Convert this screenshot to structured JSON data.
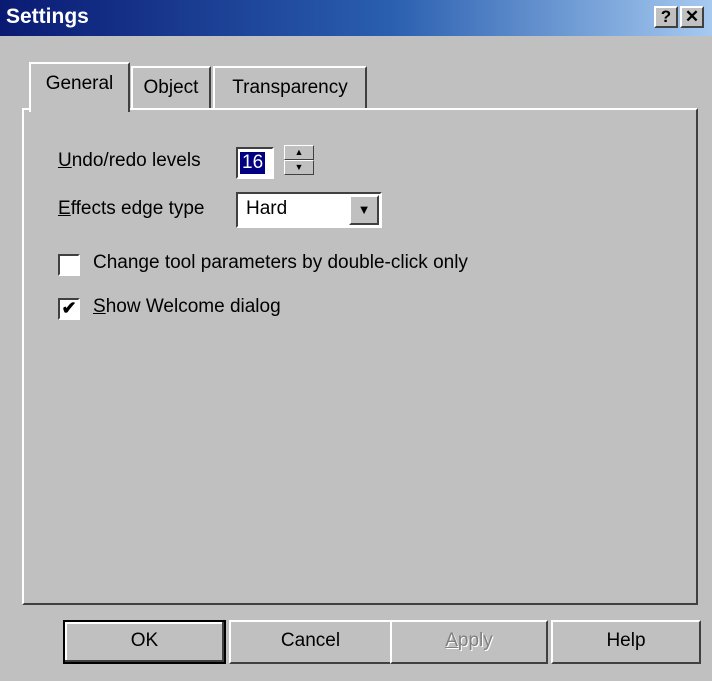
{
  "window": {
    "title": "Settings",
    "help_glyph": "?",
    "close_glyph": "✕"
  },
  "tabs": [
    {
      "label": "General",
      "active": true
    },
    {
      "label": "Object",
      "active": false
    },
    {
      "label": "Transparency",
      "active": false
    }
  ],
  "general": {
    "undo_label_mnemonic": "U",
    "undo_label_rest": "ndo/redo levels",
    "undo_value": "16",
    "edge_label_mnemonic": "E",
    "edge_label_rest": "ffects edge type",
    "edge_value": "Hard",
    "change_tool_label": "Change tool parameters by double-click only",
    "change_tool_checked": false,
    "welcome_label_mnemonic": "S",
    "welcome_label_rest": "how Welcome dialog",
    "welcome_checked": true
  },
  "buttons": {
    "ok": "OK",
    "cancel": "Cancel",
    "apply_mnemonic": "A",
    "apply_rest": "pply",
    "help": "Help"
  },
  "icons": {
    "spin_up": "▲",
    "spin_down": "▼",
    "combo_arrow": "▼",
    "check_mark": "✔"
  }
}
